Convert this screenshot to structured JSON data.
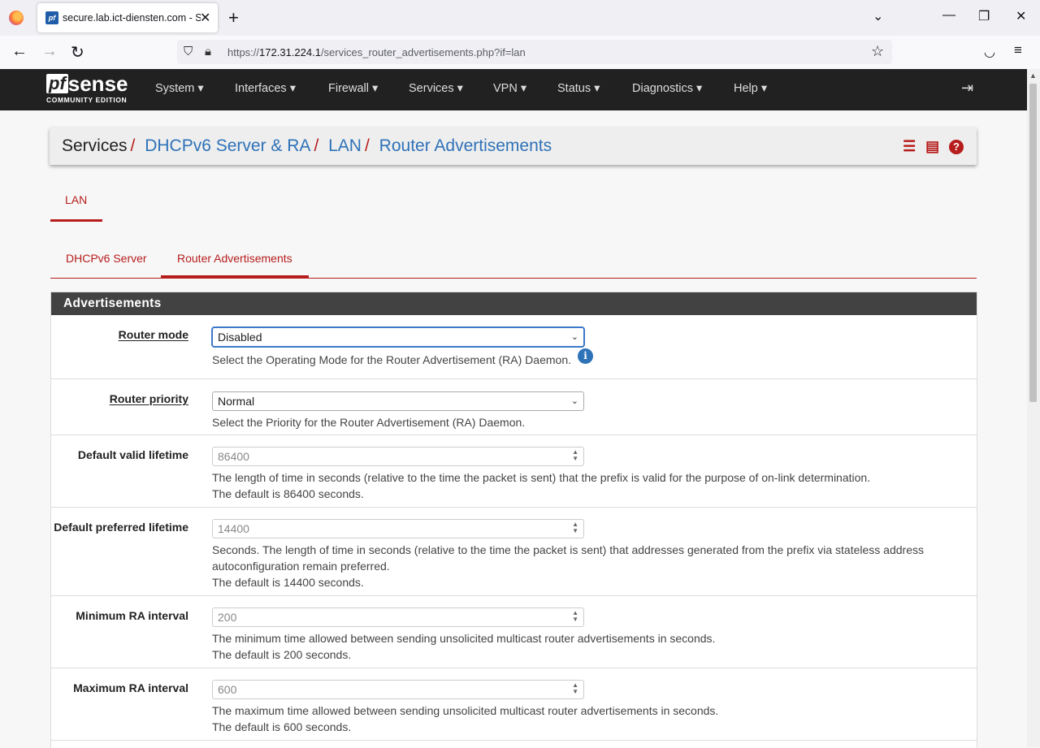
{
  "browser": {
    "tab_title": "secure.lab.ict-diensten.com - Se",
    "favicon_text": "pf",
    "url_prefix": "https://",
    "url_host": "172.31.224.1",
    "url_path": "/services_router_advertisements.php?if=lan"
  },
  "header": {
    "logo_pf": "pf",
    "logo_sense": "sense",
    "logo_edition": "COMMUNITY EDITION",
    "menu": [
      "System",
      "Interfaces",
      "Firewall",
      "Services",
      "VPN",
      "Status",
      "Diagnostics",
      "Help"
    ]
  },
  "breadcrumb": {
    "root": "Services",
    "links": [
      "DHCPv6 Server & RA",
      "LAN",
      "Router Advertisements"
    ],
    "separator": "/"
  },
  "interface_tabs": [
    {
      "label": "LAN",
      "active": true
    }
  ],
  "sub_tabs": [
    {
      "label": "DHCPv6 Server",
      "active": false
    },
    {
      "label": "Router Advertisements",
      "active": true
    }
  ],
  "panel": {
    "title": "Advertisements",
    "fields": {
      "router_mode": {
        "label": "Router mode",
        "value": "Disabled",
        "help": "Select the Operating Mode for the Router Advertisement (RA) Daemon."
      },
      "router_priority": {
        "label": "Router priority",
        "value": "Normal",
        "help": "Select the Priority for the Router Advertisement (RA) Daemon."
      },
      "default_valid_lifetime": {
        "label": "Default valid lifetime",
        "placeholder": "86400",
        "help1": "The length of time in seconds (relative to the time the packet is sent) that the prefix is valid for the purpose of on-link determination.",
        "help2": "The default is 86400 seconds."
      },
      "default_preferred_lifetime": {
        "label": "Default preferred lifetime",
        "placeholder": "14400",
        "help1": "Seconds. The length of time in seconds (relative to the time the packet is sent) that addresses generated from the prefix via stateless address",
        "help1b": "autoconfiguration remain preferred.",
        "help2": "The default is 14400 seconds."
      },
      "min_ra_interval": {
        "label": "Minimum RA interval",
        "placeholder": "200",
        "help1": "The minimum time allowed between sending unsolicited multicast router advertisements in seconds.",
        "help2": "The default is 200 seconds."
      },
      "max_ra_interval": {
        "label": "Maximum RA interval",
        "placeholder": "600",
        "help1": "The maximum time allowed between sending unsolicited multicast router advertisements in seconds.",
        "help2": "The default is 600 seconds."
      }
    }
  },
  "colors": {
    "accent": "#b71c1c",
    "link": "#2e72b8",
    "header_bg": "#212121",
    "panel_head_bg": "#424242"
  }
}
